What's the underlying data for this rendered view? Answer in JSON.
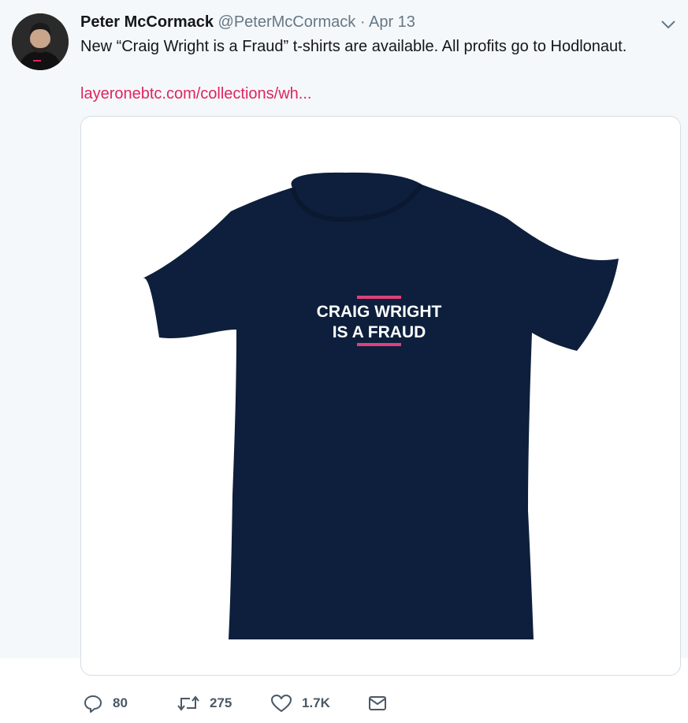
{
  "tweet": {
    "author_name": "Peter McCormack",
    "author_handle": "@PeterMcCormack",
    "separator": "·",
    "date": "Apr 13",
    "text": "New “Craig Wright is a Fraud” t-shirts are available. All profits go to Hodlonaut.",
    "link_text": "layeronebtc.com/collections/wh..."
  },
  "media": {
    "shirt_text_line1": "CRAIG WRIGHT",
    "shirt_text_line2": "IS A FRAUD",
    "shirt_color": "#0d1f3c",
    "accent_color": "#e0407c"
  },
  "actions": {
    "replies": "80",
    "retweets": "275",
    "likes": "1.7K"
  },
  "colors": {
    "page_background": "#f5f8fa",
    "link": "#e0245e",
    "muted": "#657786"
  },
  "icons": [
    "avatar",
    "chevron-down-icon",
    "reply-icon",
    "retweet-icon",
    "like-icon",
    "message-icon"
  ]
}
